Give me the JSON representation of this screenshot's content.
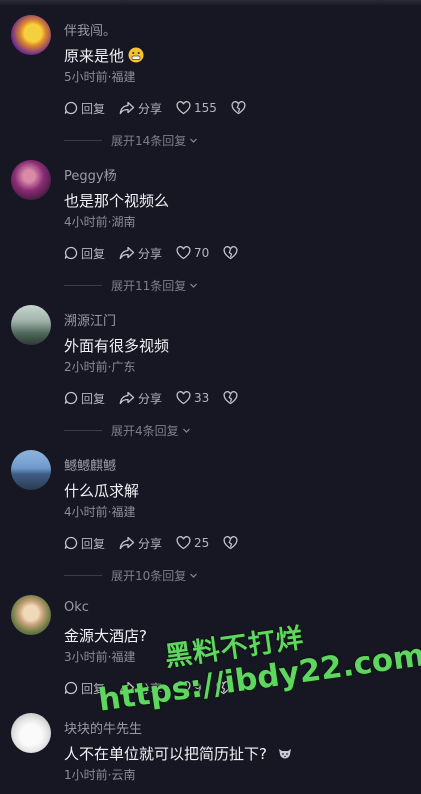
{
  "comments": [
    {
      "username": "伴我闯。",
      "text": "原来是他",
      "meta": "5小时前·福建",
      "reply_label": "回复",
      "share_label": "分享",
      "likes": "155",
      "expand": "展开14条回复"
    },
    {
      "username": "Peggy杨",
      "text": "也是那个视频么",
      "meta": "4小时前·湖南",
      "reply_label": "回复",
      "share_label": "分享",
      "likes": "70",
      "expand": "展开11条回复"
    },
    {
      "username": "溯源江门",
      "text": "外面有很多视频",
      "meta": "2小时前·广东",
      "reply_label": "回复",
      "share_label": "分享",
      "likes": "33",
      "expand": "展开4条回复"
    },
    {
      "username": "鳡鳡麒鳡",
      "text": "什么瓜求解",
      "meta": "4小时前·福建",
      "reply_label": "回复",
      "share_label": "分享",
      "likes": "25",
      "expand": "展开10条回复"
    },
    {
      "username": "Okc",
      "text": "金源大酒店?",
      "meta": "3小时前·福建",
      "reply_label": "回复",
      "share_label": "分享",
      "likes": "9",
      "expand": ""
    },
    {
      "username": "块块的牛先生",
      "text": "人不在单位就可以把简历扯下?",
      "meta": "1小时前·云南"
    }
  ],
  "watermark": {
    "line1": "黑料不打烊",
    "line2": "https://ibdy22.com"
  },
  "colors": {
    "background": "#161722",
    "watermark": "#5fd65f"
  },
  "icons": [
    "reply-icon",
    "share-icon",
    "heart-icon",
    "dislike-icon",
    "chevron-down-icon",
    "grin-emoji-icon",
    "cat-emoji-icon"
  ]
}
